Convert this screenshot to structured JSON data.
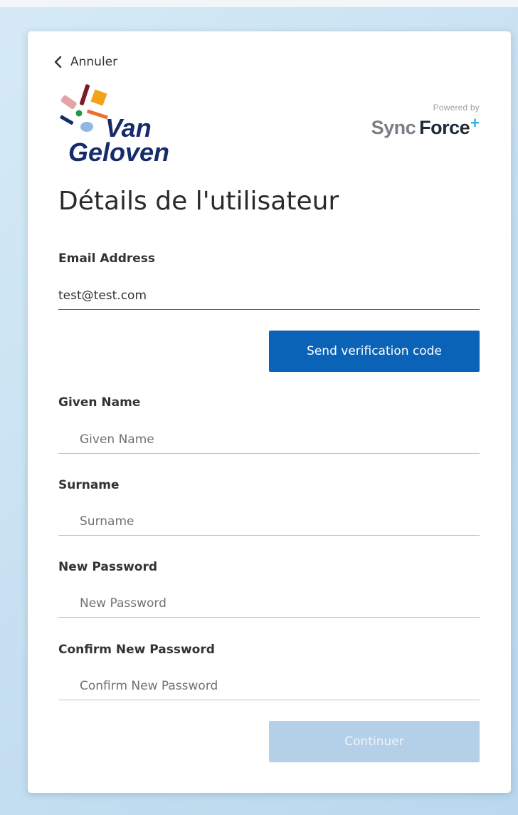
{
  "nav": {
    "cancel_label": "Annuler"
  },
  "brand": {
    "logo_line1": "Van",
    "logo_line2": "Geloven",
    "powered_by": "Powered by",
    "partner_sync": "Sync",
    "partner_force": "Force",
    "partner_plus": "+"
  },
  "page": {
    "title": "Détails de l'utilisateur"
  },
  "form": {
    "email": {
      "label": "Email Address",
      "value": "test@test.com"
    },
    "send_code_button": "Send verification code",
    "given_name": {
      "label": "Given Name",
      "placeholder": "Given Name"
    },
    "surname": {
      "label": "Surname",
      "placeholder": "Surname"
    },
    "new_password": {
      "label": "New Password",
      "placeholder": "New Password"
    },
    "confirm_password": {
      "label": "Confirm New Password",
      "placeholder": "Confirm New Password"
    },
    "continue_button": "Continuer"
  },
  "colors": {
    "primary_button": "#0b63b7",
    "disabled_button": "#b3d0e8",
    "email_underline": "#1f66b5",
    "vangeloven_navy": "#152b6b",
    "syncforce_plus": "#27b6e6"
  },
  "icons": {
    "back": "chevron-left-icon"
  }
}
